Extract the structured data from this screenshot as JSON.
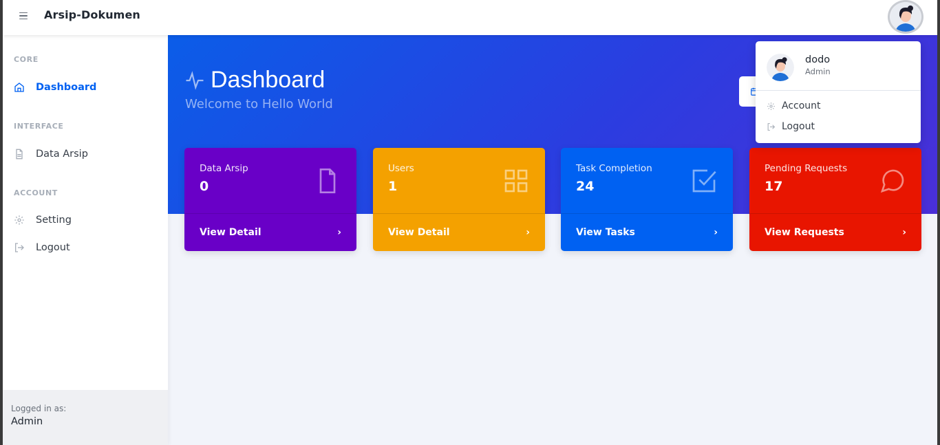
{
  "app": {
    "brand": "Arsip-Dokumen"
  },
  "sidebar": {
    "sections": [
      {
        "heading": "CORE"
      },
      {
        "heading": "INTERFACE"
      },
      {
        "heading": "ACCOUNT"
      }
    ],
    "items": [
      {
        "label": "Dashboard",
        "icon": "home-icon",
        "active": true
      },
      {
        "label": "Data Arsip",
        "icon": "file-icon"
      },
      {
        "label": "Setting",
        "icon": "gear-icon"
      },
      {
        "label": "Logout",
        "icon": "logout-icon"
      }
    ],
    "footer": {
      "subtitle": "Logged in as:",
      "user": "Admin"
    }
  },
  "header": {
    "title": "Dashboard",
    "subtitle": "Welcome to Hello World"
  },
  "cards": [
    {
      "label": "Data Arsip",
      "value": "0",
      "link": "View Detail",
      "icon": "file-icon",
      "color": "#6900c7"
    },
    {
      "label": "Users",
      "value": "1",
      "link": "View Detail",
      "icon": "grid-icon",
      "color": "#f4a100"
    },
    {
      "label": "Task Completion",
      "value": "24",
      "link": "View Tasks",
      "icon": "check-square-icon",
      "color": "#0061f2"
    },
    {
      "label": "Pending Requests",
      "value": "17",
      "link": "View Requests",
      "icon": "message-circle-icon",
      "color": "#e81500"
    }
  ],
  "user_menu": {
    "name": "dodo",
    "role": "Admin",
    "items": [
      {
        "label": "Account",
        "icon": "gear-icon"
      },
      {
        "label": "Logout",
        "icon": "logout-icon"
      }
    ]
  }
}
